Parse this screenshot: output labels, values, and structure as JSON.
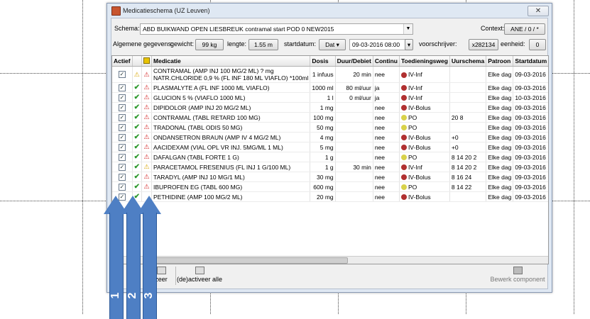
{
  "window": {
    "title": "Medicatieschema (UZ Leuven)",
    "close_glyph": "✕"
  },
  "header": {
    "schema_label": "Schema:",
    "schema_value": "ABD BUIKWAND  OPEN LIESBREUK contramal start POD 0 NEW2015",
    "context_label": "Context:",
    "context_value": "ANE / 0 / *",
    "general_label": "Algemene gegevens:",
    "weight_label": "gewicht:",
    "weight_value": "99 kg",
    "length_label": "lengte:",
    "length_value": "1.55 m",
    "startdate_label": "startdatum:",
    "startdate_button": "Dat ▾",
    "startdate_value": "09-03-2016 08:00",
    "prescriber_label": "voorschrijver:",
    "prescriber_value": "x282134",
    "unit_label": "eenheid:",
    "unit_value": "0"
  },
  "table": {
    "columns": [
      "Actief",
      "",
      "",
      "Medicatie",
      "Dosis",
      "Duur/Debiet",
      "Continu",
      "Toedieningsweg",
      "Uurschema",
      "Patroon",
      "Startdatum"
    ],
    "rows": [
      {
        "warn": "yellow",
        "medicatie": "CONTRAMAL (AMP INJ 100 MG/2 ML) ? mg",
        "medicatie2": "NATR.CHLORIDE 0,9 % (FL INF  180 ML VIAFLO) *100ml",
        "dosis": "1 infuus",
        "duur": "20 min",
        "continu": "nee",
        "weg": "IV-Inf",
        "uur": "",
        "patroon": "Elke dag",
        "start": "09-03-2016",
        "route": "iv",
        "check": false,
        "tall": true
      },
      {
        "warn": "red",
        "medicatie": "PLASMALYTE A (FL INF 1000 ML VIAFLO)",
        "dosis": "1000 ml",
        "duur": "80 ml/uur",
        "continu": "ja",
        "weg": "IV-Inf",
        "uur": "",
        "patroon": "Elke dag",
        "start": "09-03-2016",
        "route": "iv",
        "check": true
      },
      {
        "warn": "red",
        "medicatie": "GLUCION  5 % (VIAFLO 1000 ML)",
        "dosis": "1 l",
        "duur": "0 ml/uur",
        "continu": "ja",
        "weg": "IV-Inf",
        "uur": "",
        "patroon": "Elke dag",
        "start": "10-03-2016",
        "route": "iv",
        "check": true
      },
      {
        "warn": "red",
        "medicatie": "DIPIDOLOR (AMP INJ 20 MG/2 ML)",
        "dosis": "1 mg",
        "duur": "",
        "continu": "nee",
        "weg": "IV-Bolus",
        "uur": "",
        "patroon": "Elke dag",
        "start": "09-03-2016",
        "route": "iv",
        "check": true
      },
      {
        "warn": "red",
        "medicatie": "CONTRAMAL (TABL RETARD 100 MG)",
        "dosis": "100 mg",
        "duur": "",
        "continu": "nee",
        "weg": "PO",
        "uur": "20 8",
        "patroon": "Elke dag",
        "start": "09-03-2016",
        "route": "po",
        "check": true
      },
      {
        "warn": "red",
        "medicatie": "TRADONAL (TABL ODIS 50 MG)",
        "dosis": "50 mg",
        "duur": "",
        "continu": "nee",
        "weg": "PO",
        "uur": "",
        "patroon": "Elke dag",
        "start": "09-03-2016",
        "route": "po",
        "check": true
      },
      {
        "warn": "red",
        "medicatie": "ONDANSETRON BRAUN (AMP IV 4 MG/2 ML)",
        "dosis": "4 mg",
        "duur": "",
        "continu": "nee",
        "weg": "IV-Bolus",
        "uur": "+0",
        "patroon": "Elke dag",
        "start": "09-03-2016",
        "route": "iv",
        "check": true
      },
      {
        "warn": "red",
        "medicatie": "AACIDEXAM (VIAL OPL VR INJ. 5MG/ML 1 ML)",
        "dosis": "5 mg",
        "duur": "",
        "continu": "nee",
        "weg": "IV-Bolus",
        "uur": "+0",
        "patroon": "Elke dag",
        "start": "09-03-2016",
        "route": "iv",
        "check": true
      },
      {
        "warn": "red",
        "medicatie": "DAFALGAN (TABL FORTE 1 G)",
        "dosis": "1 g",
        "duur": "",
        "continu": "nee",
        "weg": "PO",
        "uur": "8 14 20 2",
        "patroon": "Elke dag",
        "start": "09-03-2016",
        "route": "po",
        "check": true
      },
      {
        "warn": "yellow",
        "medicatie": "PARACETAMOL FRESENIUS (FL INJ 1 G/100 ML)",
        "dosis": "1 g",
        "duur": "30 min",
        "continu": "nee",
        "weg": "IV-Inf",
        "uur": "8 14 20 2",
        "patroon": "Elke dag",
        "start": "09-03-2016",
        "route": "iv",
        "check": true
      },
      {
        "warn": "red",
        "medicatie": "TARADYL (AMP INJ 10 MG/1 ML)",
        "dosis": "30 mg",
        "duur": "",
        "continu": "nee",
        "weg": "IV-Bolus",
        "uur": "8 16 24",
        "patroon": "Elke dag",
        "start": "09-03-2016",
        "route": "iv",
        "check": true
      },
      {
        "warn": "red",
        "medicatie": "IBUPROFEN EG (TABL 600 MG)",
        "dosis": "600 mg",
        "duur": "",
        "continu": "nee",
        "weg": "PO",
        "uur": "8 14 22",
        "patroon": "Elke dag",
        "start": "09-03-2016",
        "route": "po",
        "check": true
      },
      {
        "warn": "",
        "medicatie": "PETHIDINE (AMP 100 MG/2 ML)",
        "dosis": "20 mg",
        "duur": "",
        "continu": "nee",
        "weg": "IV-Bolus",
        "uur": "",
        "patroon": "Elke dag",
        "start": "09-03-2016",
        "route": "iv",
        "check": true
      }
    ]
  },
  "bottom": {
    "left_label": "zeer",
    "toggle_all_label": "(de)activeer alle",
    "edit_component_label": "Bewerk component"
  },
  "arrows": [
    {
      "label": "1"
    },
    {
      "label": "2"
    },
    {
      "label": "3"
    }
  ],
  "colors": {
    "arrow": "#4e7fc4",
    "check": "#2f9a2f",
    "warn_red": "#d32020",
    "warn_yellow": "#d9a400"
  }
}
